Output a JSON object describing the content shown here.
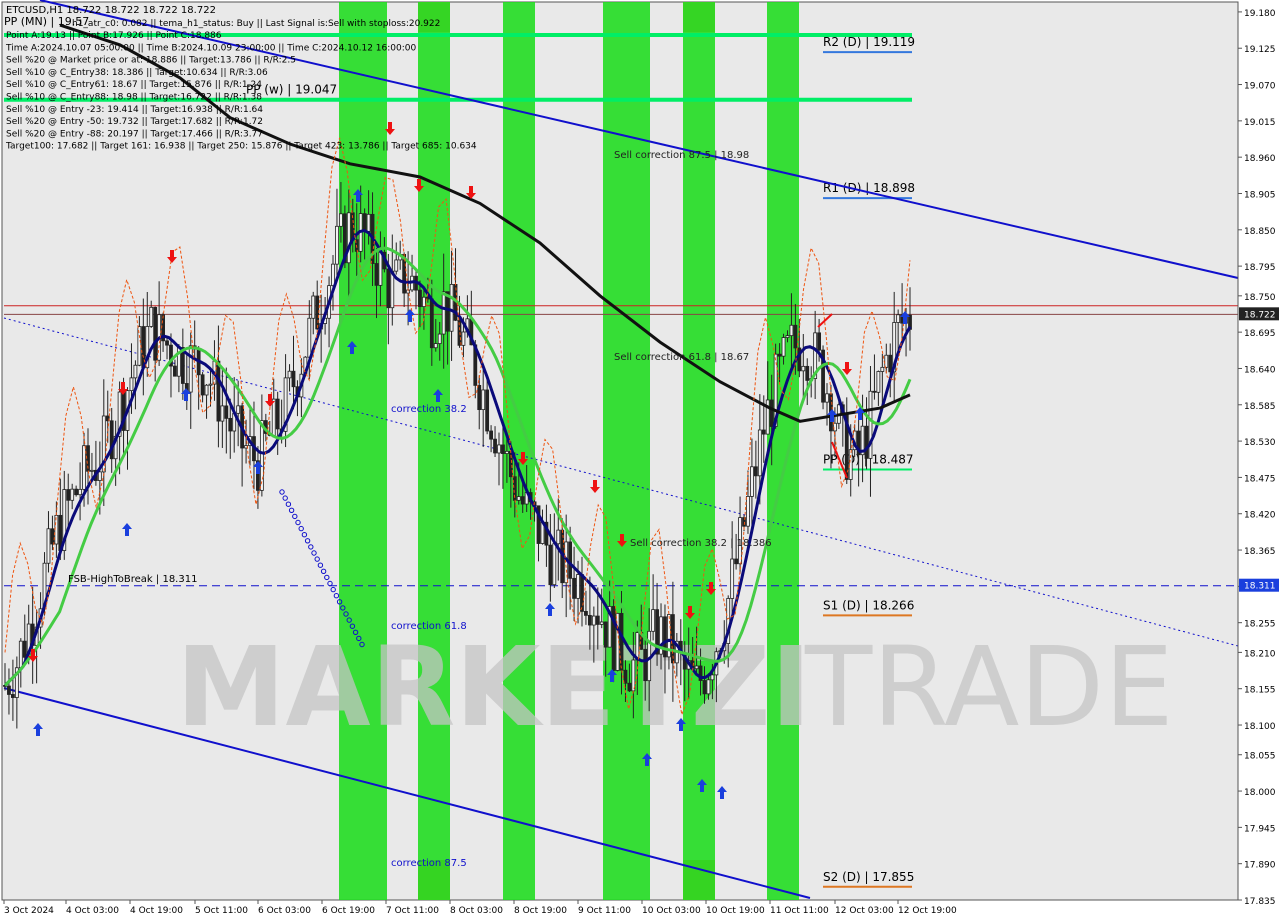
{
  "header": {
    "symbol_line": "ETCUSD,H1  18.722 18.722 18.722 18.722",
    "line2": "PP (MN) | 19.57",
    "line2b": "h1_atr_c0: 0.082 || tema_h1_status: Buy || Last Signal is:Sell with stoploss:20.922",
    "lines": [
      "Point A:19.13 || Point B:17.926 || Point C:18.886",
      "Time A:2024.10.07 05:00:00 || Time B:2024.10.09 23:00:00 || Time C:2024.10.12 16:00:00",
      "Sell %20 @ Market price or at: 18.886 || Target:13.786 || R/R:2.5",
      "Sell %10 @ C_Entry38: 18.386 || Target:10.634 || R/R:3.06",
      "Sell %10 @ C_Entry61: 18.67 || Target:15.876 || R/R:1.24",
      "Sell %10 @ C_Entry88: 18.98 || Target:16.722 || R/R:1.38",
      "Sell %10 @ Entry -23: 19.414 || Target:16.938 || R/R:1.64",
      "Sell %20 @ Entry -50: 19.732 || Target:17.682 || R/R:1.72",
      "Sell %20 @ Entry -88: 20.197 || Target:17.466 || R/R:3.77",
      "Target100: 17.682 || Target 161: 16.938 || Target 250: 15.876 || Target 423: 13.786 || Target 685: 10.634"
    ]
  },
  "watermark": {
    "left": "MARKETZI",
    "right": "TRADE"
  },
  "colors": {
    "green_band": "#22dd22",
    "orange_band": "#dd8822",
    "channel": "#1010cc",
    "ema_black": "#111111",
    "ema_navy": "#0a0a7a",
    "ema_green": "#44cc44",
    "price_line": "#cc2222",
    "level_green": "#00ee66",
    "level_blue": "#3377dd",
    "level_orange": "#dd7722"
  },
  "chart_data": {
    "type": "line",
    "symbol": "ETCUSD,H1",
    "ylim": [
      17.835,
      19.195
    ],
    "y_ticks": [
      "19.180",
      "19.125",
      "19.070",
      "19.015",
      "18.960",
      "18.905",
      "18.850",
      "18.795",
      "18.750",
      "18.695",
      "18.640",
      "18.585",
      "18.530",
      "18.475",
      "18.420",
      "18.365",
      "18.310",
      "18.255",
      "18.210",
      "18.155",
      "18.100",
      "18.055",
      "18.000",
      "17.945",
      "17.890",
      "17.835"
    ],
    "x_ticks": [
      "3 Oct 2024",
      "4 Oct 03:00",
      "4 Oct 19:00",
      "5 Oct 11:00",
      "6 Oct 03:00",
      "6 Oct 19:00",
      "7 Oct 11:00",
      "8 Oct 03:00",
      "8 Oct 19:00",
      "9 Oct 11:00",
      "10 Oct 03:00",
      "10 Oct 19:00",
      "11 Oct 11:00",
      "12 Oct 03:00",
      "12 Oct 19:00"
    ],
    "current_price": "18.722",
    "price_tag_2": "18.311",
    "levels": [
      {
        "label": "R2 (D) | 19.119",
        "value": 19.119,
        "color": "#3377dd"
      },
      {
        "label": "PP (w) | 19.047",
        "value": 19.047,
        "color": "#00ee66"
      },
      {
        "label": "R1 (D) | 18.898",
        "value": 18.898,
        "color": "#3377dd"
      },
      {
        "label": "PP (D) | 18.487",
        "value": 18.487,
        "color": "#00ee66"
      },
      {
        "label": "S1 (D) | 18.266",
        "value": 18.266,
        "color": "#dd7722"
      },
      {
        "label": "S2 (D) | 17.855",
        "value": 17.855,
        "color": "#dd7722"
      }
    ],
    "annotations": [
      {
        "text": "Sell correction 87.5 | 18.98",
        "value": 18.98
      },
      {
        "text": "Sell correction 61.8 | 18.67",
        "value": 18.67
      },
      {
        "text": "Sell correction 38.2 | 18.386",
        "value": 18.386
      },
      {
        "text": "correction 38.2",
        "value": 18.57
      },
      {
        "text": "correction 61.8",
        "value": 18.23
      },
      {
        "text": "correction 87.5",
        "value": 17.89
      },
      {
        "text": "FSB-HighToBreak | 18.311",
        "value": 18.311
      }
    ],
    "series": [
      {
        "values": [
          18.16,
          18.2,
          18.26,
          18.33,
          18.4,
          18.44,
          18.48,
          18.5,
          18.55,
          18.6,
          18.66,
          18.7,
          18.68,
          18.66,
          18.65,
          18.64,
          18.6,
          18.55,
          18.52,
          18.5,
          18.54,
          18.58,
          18.64,
          18.7,
          18.76,
          18.82,
          18.86,
          18.84,
          18.8,
          18.76,
          18.78,
          18.76,
          18.72,
          18.74,
          18.7,
          18.66,
          18.6,
          18.54,
          18.48,
          18.43,
          18.4,
          18.36,
          18.34,
          18.32,
          18.3,
          18.26,
          18.22,
          18.19,
          18.2,
          18.24,
          18.22,
          18.18,
          18.16,
          18.2,
          18.26,
          18.35,
          18.45,
          18.55,
          18.62,
          18.67,
          18.68,
          18.65,
          18.6,
          18.52,
          18.5,
          18.56,
          18.64,
          18.7,
          18.72
        ]
      },
      {
        "values": [
          18.26,
          18.31,
          18.38,
          18.5,
          18.62,
          18.68,
          18.85,
          18.69,
          18.6,
          18.56,
          18.7,
          18.95,
          18.78,
          18.82,
          18.78,
          18.65,
          18.62,
          18.55,
          18.4,
          18.34,
          18.3,
          18.38,
          18.42,
          18.36,
          18.3,
          18.24,
          18.15,
          17.97,
          18.22,
          18.28,
          18.18,
          18.12,
          18.17,
          18.07,
          18.08,
          18.28,
          18.55,
          18.7,
          18.67,
          18.56,
          18.78,
          18.86,
          18.83,
          18.72
        ]
      }
    ]
  }
}
